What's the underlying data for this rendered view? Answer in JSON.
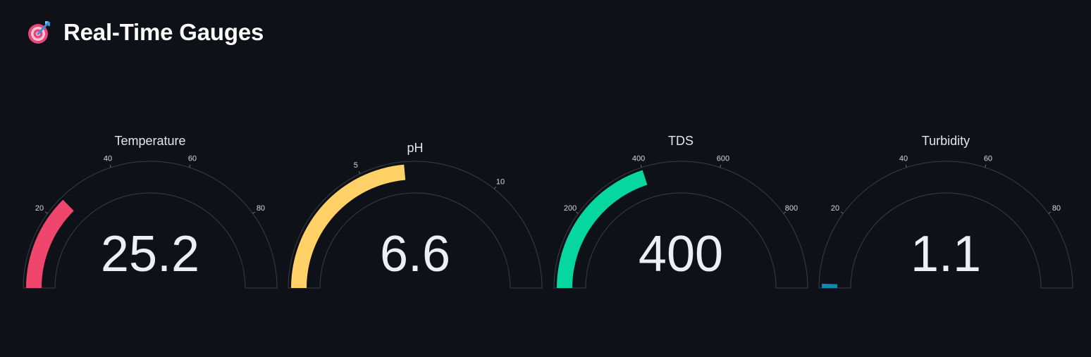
{
  "header": {
    "title": "Real-Time Gauges",
    "icon": "target-dart-icon"
  },
  "chart_data": [
    {
      "type": "gauge",
      "title": "Temperature",
      "value": "25.2",
      "range": [
        0,
        100
      ],
      "ticks": [
        20,
        40,
        60,
        80
      ],
      "bar_color": "#f0466e"
    },
    {
      "type": "gauge",
      "title": "pH",
      "value": "6.6",
      "range": [
        0,
        14
      ],
      "ticks": [
        5,
        10
      ],
      "bar_color": "#ffd166"
    },
    {
      "type": "gauge",
      "title": "TDS",
      "value": "400",
      "range": [
        0,
        1000
      ],
      "ticks": [
        200,
        400,
        600,
        800
      ],
      "bar_color": "#06d6a0"
    },
    {
      "type": "gauge",
      "title": "Turbidity",
      "value": "1.1",
      "range": [
        0,
        100
      ],
      "ticks": [
        20,
        40,
        60,
        80
      ],
      "bar_color": "#118ab2"
    }
  ]
}
